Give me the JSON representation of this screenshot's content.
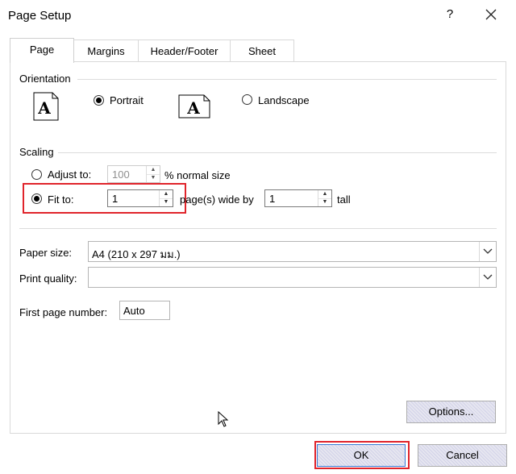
{
  "window": {
    "title": "Page Setup",
    "help_label": "?"
  },
  "tabs": [
    {
      "label": "Page",
      "active": true
    },
    {
      "label": "Margins",
      "active": false
    },
    {
      "label": "Header/Footer",
      "active": false
    },
    {
      "label": "Sheet",
      "active": false
    }
  ],
  "orientation": {
    "heading": "Orientation",
    "portrait_label": "Portrait",
    "portrait_selected": true,
    "landscape_label": "Landscape",
    "landscape_selected": false,
    "icon_letter": "A"
  },
  "scaling": {
    "heading": "Scaling",
    "adjust_to_label": "Adjust to:",
    "adjust_to_selected": false,
    "adjust_to_value": "100",
    "normal_size_label": "% normal size",
    "fit_to_label": "Fit to:",
    "fit_to_selected": true,
    "fit_wide_value": "1",
    "pages_wide_label": "page(s) wide by",
    "fit_tall_value": "1",
    "tall_label": "tall"
  },
  "paper": {
    "paper_size_label": "Paper size:",
    "paper_size_value": "A4 (210 x 297 มม.)",
    "print_quality_label": "Print quality:",
    "print_quality_value": "",
    "first_page_label": "First page number:",
    "first_page_value": "Auto"
  },
  "buttons": {
    "options_label": "Options...",
    "ok_label": "OK",
    "cancel_label": "Cancel"
  },
  "colors": {
    "highlight": "#e0242b",
    "button_face": "#e6e6f0",
    "ok_border": "#3a7bd5"
  }
}
